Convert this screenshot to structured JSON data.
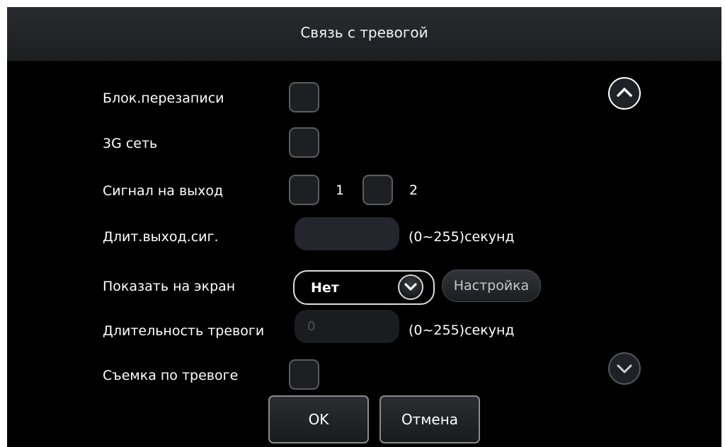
{
  "dialog": {
    "title": "Связь с тревогой"
  },
  "rows": {
    "block_overwrite": {
      "label": "Блок.перезаписи"
    },
    "network_3g": {
      "label": "3G сеть"
    },
    "output_signal": {
      "label": "Сигнал на выход",
      "option_1": "1",
      "option_2": "2"
    },
    "output_duration": {
      "label": "Длит.выход.сиг.",
      "value": "",
      "unit": "(0~255)секунд"
    },
    "show_on_screen": {
      "label": "Показать на экран",
      "selected": "Нет",
      "setup_label": "Настройка"
    },
    "alarm_duration": {
      "label": "Длительность тревоги",
      "value": "0",
      "unit": "(0~255)секунд"
    },
    "alarm_snapshot": {
      "label": "Съемка по тревоге"
    }
  },
  "buttons": {
    "ok": "OK",
    "cancel": "Отмена"
  },
  "icons": {
    "scroll_up": "chevron-up-icon",
    "scroll_down": "chevron-down-icon",
    "dropdown": "chevron-down-icon"
  },
  "colors": {
    "background": "#000000",
    "title_bar": "#25262a",
    "checkbox_fill": "#1e1f23",
    "field_fill": "#24252d"
  }
}
